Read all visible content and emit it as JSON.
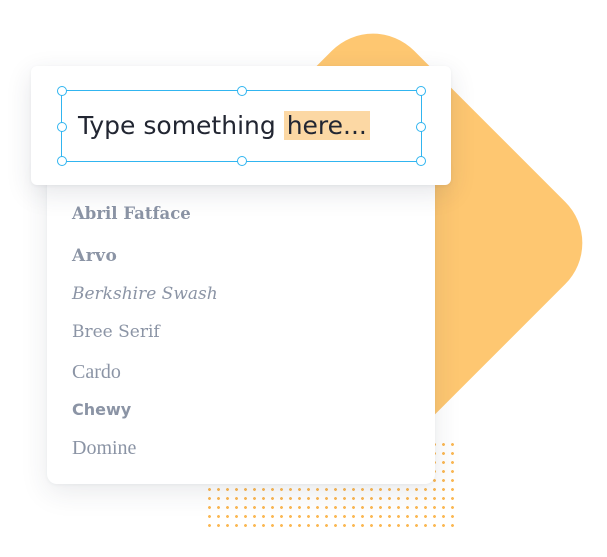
{
  "editor": {
    "text_before": "Type something ",
    "text_highlighted": "here...",
    "highlight_color": "#fcd8a4",
    "selection_color": "#31b5f0"
  },
  "font_list": {
    "items": [
      {
        "label": "Abril Fatface"
      },
      {
        "label": "Arvo"
      },
      {
        "label": "Berkshire Swash"
      },
      {
        "label": "Bree Serif"
      },
      {
        "label": "Cardo"
      },
      {
        "label": "Chewy"
      },
      {
        "label": "Domine"
      }
    ],
    "text_color": "#8b94a5"
  },
  "decoration": {
    "diamond_color": "#fec771",
    "dots_color": "#fbb956"
  }
}
